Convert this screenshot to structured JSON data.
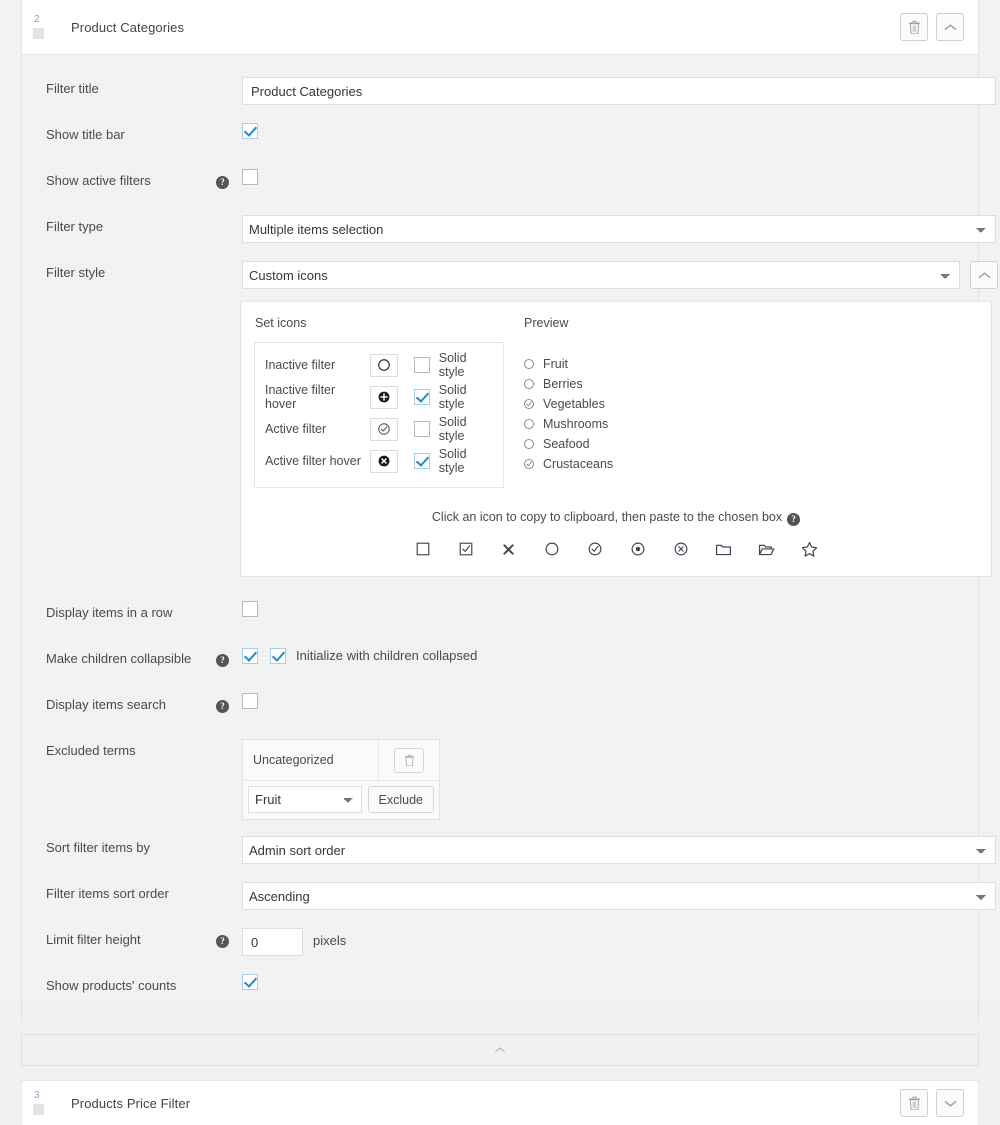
{
  "header": {
    "index": "2",
    "title": "Product Categories",
    "delete_icon": "trash-icon",
    "collapse_icon": "chevron-up-icon"
  },
  "rows": {
    "filter_title": {
      "label": "Filter title",
      "value": "Product Categories"
    },
    "show_title_bar": {
      "label": "Show title bar",
      "checked": "true"
    },
    "show_active_filters": {
      "label": "Show active filters",
      "checked": "false",
      "help": "?"
    },
    "filter_type": {
      "label": "Filter type",
      "value": "Multiple items selection"
    },
    "filter_style": {
      "label": "Filter style",
      "value": "Custom icons",
      "toggle_icon": "chevron-up-icon"
    },
    "display_items_row": {
      "label": "Display items in a row",
      "checked": "false"
    },
    "make_children_collapsible": {
      "label": "Make children collapsible",
      "help": "?",
      "checked": "true",
      "secondary_checked": "true",
      "secondary_label": "Initialize with children collapsed"
    },
    "display_items_search": {
      "label": "Display items search",
      "help": "?",
      "checked": "false"
    },
    "excluded_terms": {
      "label": "Excluded terms",
      "items": [
        "Uncategorized"
      ],
      "select_value": "Fruit",
      "exclude_button": "Exclude",
      "delete_icon": "trash-icon"
    },
    "sort_filter_items_by": {
      "label": "Sort filter items by",
      "value": "Admin sort order"
    },
    "filter_items_sort_order": {
      "label": "Filter items sort order",
      "value": "Ascending"
    },
    "limit_filter_height": {
      "label": "Limit filter height",
      "help": "?",
      "value": "0",
      "suffix": "pixels"
    },
    "show_products_counts": {
      "label": "Show products' counts",
      "checked": "true"
    }
  },
  "icons_panel": {
    "set_icons_heading": "Set icons",
    "preview_heading": "Preview",
    "set_rows": [
      {
        "label": "Inactive filter",
        "icon": "circle-outline-icon",
        "solid_label": "Solid style",
        "solid_checked": "false"
      },
      {
        "label": "Inactive filter hover",
        "icon": "plus-circle-solid-icon",
        "solid_label": "Solid style",
        "solid_checked": "true"
      },
      {
        "label": "Active filter",
        "icon": "check-circle-outline-icon",
        "solid_label": "Solid style",
        "solid_checked": "false"
      },
      {
        "label": "Active filter hover",
        "icon": "x-circle-solid-icon",
        "solid_label": "Solid style",
        "solid_checked": "true"
      }
    ],
    "preview_items": [
      {
        "label": "Fruit",
        "icon": "circle-outline-icon",
        "state": "inactive"
      },
      {
        "label": "Berries",
        "icon": "circle-outline-icon",
        "state": "inactive"
      },
      {
        "label": "Vegetables",
        "icon": "check-circle-outline-icon",
        "state": "active"
      },
      {
        "label": "Mushrooms",
        "icon": "circle-outline-icon",
        "state": "inactive"
      },
      {
        "label": "Seafood",
        "icon": "circle-outline-icon",
        "state": "inactive"
      },
      {
        "label": "Crustaceans",
        "icon": "check-circle-outline-icon",
        "state": "active"
      }
    ],
    "hint": "Click an icon to copy to clipboard, then paste to the chosen box",
    "hint_help": "?",
    "palette": [
      "square-icon",
      "checked-square-icon",
      "x-icon",
      "circle-icon",
      "check-circle-icon",
      "dot-circle-icon",
      "x-circle-icon",
      "folder-icon",
      "folder-open-icon",
      "star-icon"
    ]
  },
  "footer": {
    "collapse_icon": "chevron-up-icon"
  },
  "next_widget": {
    "index": "3",
    "title": "Products Price Filter",
    "delete_icon": "trash-icon",
    "expand_icon": "chevron-down-icon"
  },
  "colors": {
    "accent": "#1e8cbe",
    "page_bg": "#f1f1f1",
    "panel_bg": "#ffffff",
    "border": "#e5e5e5",
    "text": "#4a4a4a"
  }
}
